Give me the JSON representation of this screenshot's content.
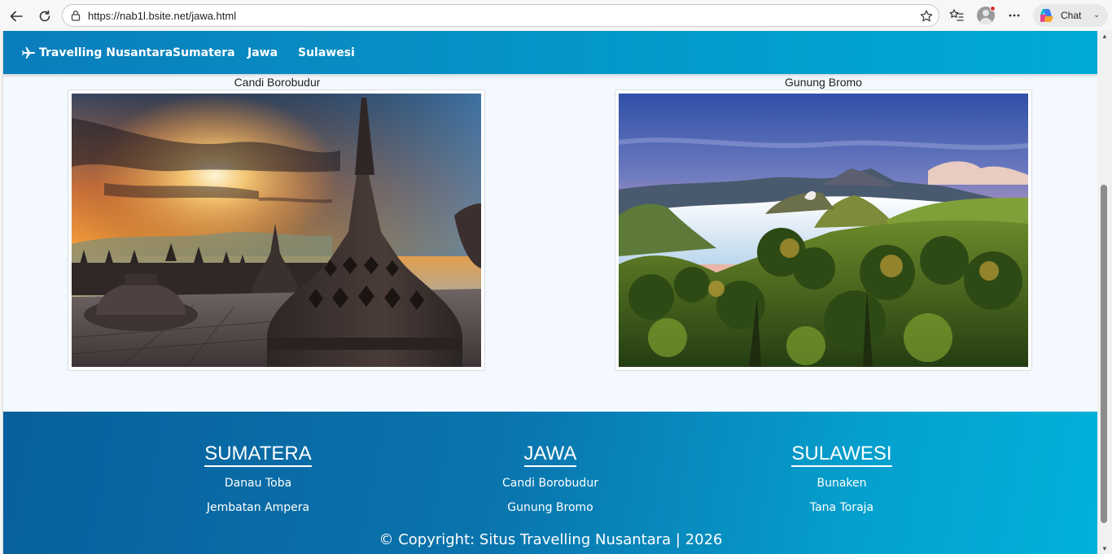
{
  "browser": {
    "url": "https://nab1l.bsite.net/jawa.html",
    "chat_label": "Chat"
  },
  "site": {
    "brand": "Travelling Nusantara",
    "nav": [
      "Sumatera",
      "Jawa",
      "Sulawesi"
    ]
  },
  "gallery": [
    {
      "title": "Candi Borobudur"
    },
    {
      "title": "Gunung Bromo"
    }
  ],
  "footer": {
    "columns": [
      {
        "heading": "SUMATERA",
        "links": [
          "Danau Toba",
          "Jembatan Ampera"
        ]
      },
      {
        "heading": "JAWA",
        "links": [
          "Candi Borobudur",
          "Gunung Bromo"
        ]
      },
      {
        "heading": "SULAWESI",
        "links": [
          "Bunaken",
          "Tana Toraja"
        ]
      }
    ],
    "copyright": "© Copyright: Situs Travelling Nusantara | 2026"
  },
  "colors": {
    "nav_gradient_start": "#0a7dbb",
    "nav_gradient_end": "#00abd6",
    "footer_gradient_start": "#08609c",
    "footer_gradient_end": "#00b2da",
    "page_background": "#f3f9ff"
  }
}
